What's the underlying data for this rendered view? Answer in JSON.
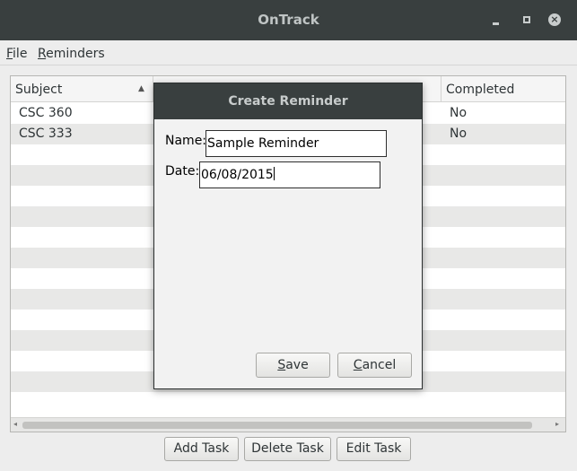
{
  "window": {
    "title": "OnTrack",
    "minimize_icon": "minimize-icon",
    "maximize_icon": "maximize-icon",
    "close_icon": "close-icon",
    "close_glyph": "×"
  },
  "menubar": {
    "file": {
      "mnemonic": "F",
      "rest": "ile"
    },
    "reminders": {
      "mnemonic": "R",
      "rest": "eminders"
    }
  },
  "table": {
    "columns": {
      "subject": "Subject",
      "completed": "Completed"
    },
    "sort_indicator": "▲",
    "rows": [
      {
        "subject": "CSC 360",
        "completed": "No"
      },
      {
        "subject": "CSC 333",
        "completed": "No"
      }
    ],
    "scroll_left": "◂",
    "scroll_right": "▸"
  },
  "buttons": {
    "add_task": "Add Task",
    "delete_task": "Delete Task",
    "edit_task": "Edit Task"
  },
  "dialog": {
    "title": "Create Reminder",
    "name_label": "Name:",
    "name_value": "Sample Reminder",
    "date_label": "Date:",
    "date_value": "06/08/2015",
    "save": {
      "mnemonic": "S",
      "rest": "ave"
    },
    "cancel": {
      "mnemonic": "C",
      "rest": "ancel"
    }
  },
  "colors": {
    "titlebar": "#393f3f",
    "window_bg": "#ededed",
    "row_alt": "#e8e8e7"
  }
}
